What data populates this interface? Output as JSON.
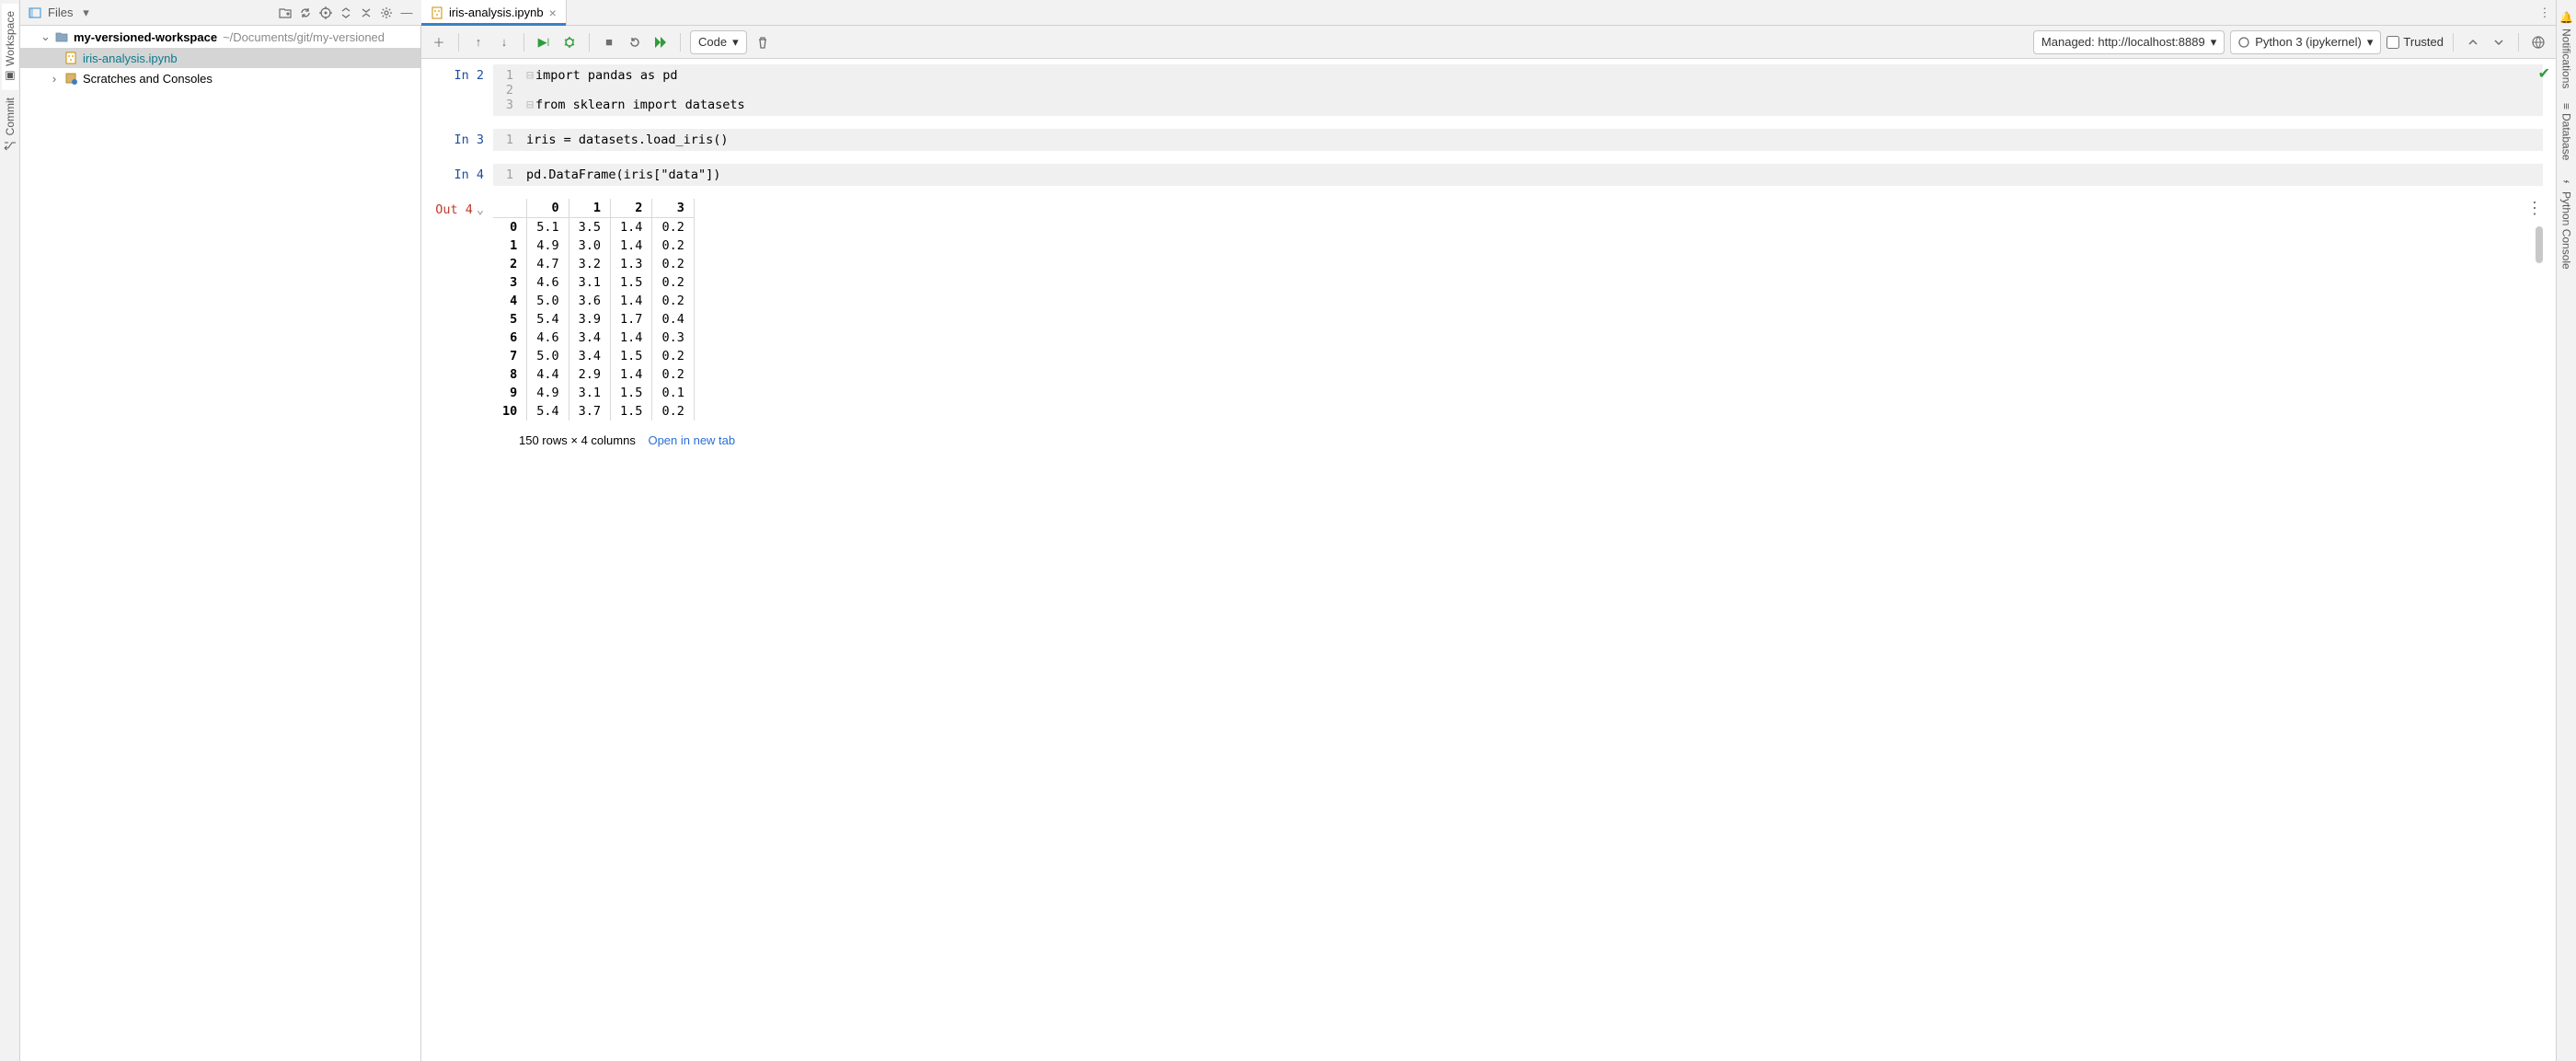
{
  "left_tabs": {
    "workspace": "Workspace",
    "commit": "Commit"
  },
  "right_tabs": {
    "notifications": "Notifications",
    "database": "Database",
    "python_console": "Python Console"
  },
  "project_panel": {
    "title": "Files",
    "root_name": "my-versioned-workspace",
    "root_path": "~/Documents/git/my-versioned",
    "file": "iris-analysis.ipynb",
    "scratches": "Scratches and Consoles"
  },
  "editor_tab": {
    "name": "iris-analysis.ipynb"
  },
  "nb_toolbar": {
    "cell_type": "Code",
    "server": "Managed: http://localhost:8889",
    "kernel": "Python 3 (ipykernel)",
    "trusted": "Trusted"
  },
  "cells": {
    "in2": {
      "prompt": "In 2",
      "l1": "import pandas as pd",
      "l2": "",
      "l3": "from sklearn import datasets"
    },
    "in3": {
      "prompt": "In 3",
      "code": "iris = datasets.load_iris()"
    },
    "in4": {
      "prompt": "In 4",
      "code": "pd.DataFrame(iris[\"data\"])"
    },
    "out4": {
      "prompt": "Out 4"
    }
  },
  "dataframe": {
    "columns": [
      "0",
      "1",
      "2",
      "3"
    ],
    "rows": [
      {
        "i": "0",
        "v": [
          "5.1",
          "3.5",
          "1.4",
          "0.2"
        ]
      },
      {
        "i": "1",
        "v": [
          "4.9",
          "3.0",
          "1.4",
          "0.2"
        ]
      },
      {
        "i": "2",
        "v": [
          "4.7",
          "3.2",
          "1.3",
          "0.2"
        ]
      },
      {
        "i": "3",
        "v": [
          "4.6",
          "3.1",
          "1.5",
          "0.2"
        ]
      },
      {
        "i": "4",
        "v": [
          "5.0",
          "3.6",
          "1.4",
          "0.2"
        ]
      },
      {
        "i": "5",
        "v": [
          "5.4",
          "3.9",
          "1.7",
          "0.4"
        ]
      },
      {
        "i": "6",
        "v": [
          "4.6",
          "3.4",
          "1.4",
          "0.3"
        ]
      },
      {
        "i": "7",
        "v": [
          "5.0",
          "3.4",
          "1.5",
          "0.2"
        ]
      },
      {
        "i": "8",
        "v": [
          "4.4",
          "2.9",
          "1.4",
          "0.2"
        ]
      },
      {
        "i": "9",
        "v": [
          "4.9",
          "3.1",
          "1.5",
          "0.1"
        ]
      },
      {
        "i": "10",
        "v": [
          "5.4",
          "3.7",
          "1.5",
          "0.2"
        ]
      }
    ],
    "summary": "150 rows × 4 columns",
    "open_link": "Open in new tab"
  }
}
